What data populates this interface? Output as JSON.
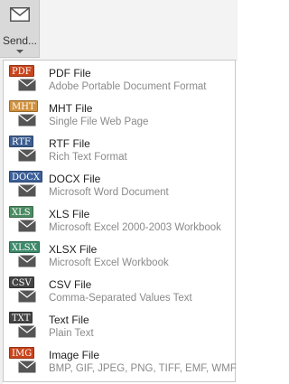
{
  "ribbon": {
    "send_button": {
      "label": "Send...",
      "icon": "envelope-icon"
    }
  },
  "menu": {
    "items": [
      {
        "tag": "PDF",
        "tag_color": "#c9451c",
        "title": "PDF File",
        "description": "Adobe Portable Document Format"
      },
      {
        "tag": "MHT",
        "tag_color": "#d0913e",
        "title": "MHT File",
        "description": "Single File Web Page"
      },
      {
        "tag": "RTF",
        "tag_color": "#3d5e8f",
        "title": "RTF File",
        "description": "Rich Text Format"
      },
      {
        "tag": "DOCX",
        "tag_color": "#3b5f97",
        "title": "DOCX File",
        "description": "Microsoft Word Document"
      },
      {
        "tag": "XLS",
        "tag_color": "#4b8b62",
        "title": "XLS File",
        "description": "Microsoft Excel 2000-2003 Workbook"
      },
      {
        "tag": "XLSX",
        "tag_color": "#3d8a6a",
        "title": "XLSX File",
        "description": "Microsoft Excel Workbook"
      },
      {
        "tag": "CSV",
        "tag_color": "#444444",
        "title": "CSV File",
        "description": "Comma-Separated Values Text"
      },
      {
        "tag": "TXT",
        "tag_color": "#444444",
        "title": "Text File",
        "description": "Plain Text"
      },
      {
        "tag": "IMG",
        "tag_color": "#c9451c",
        "title": "Image File",
        "description": "BMP, GIF, JPEG, PNG, TIFF, EMF, WMF"
      }
    ]
  }
}
